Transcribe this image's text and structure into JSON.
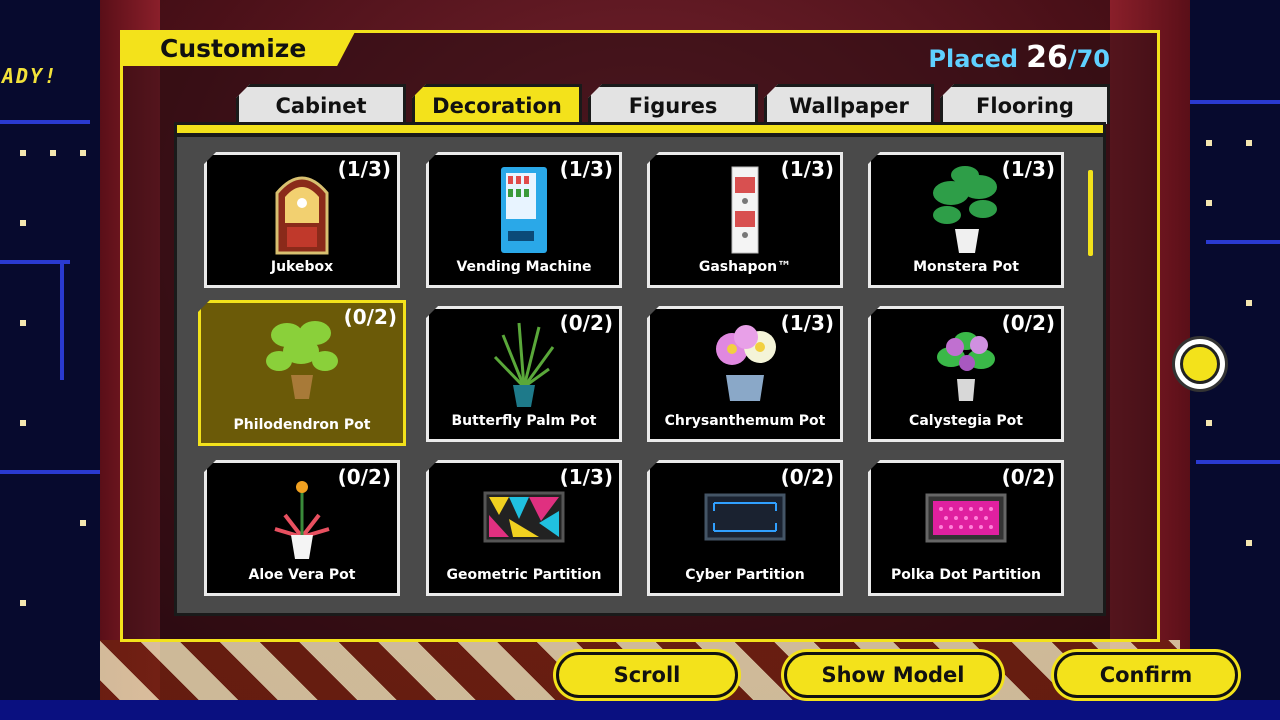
{
  "header": {
    "title": "Customize",
    "placed_label": "Placed",
    "placed_current": "26",
    "placed_total": "/70"
  },
  "background": {
    "ready_text": "ADY!"
  },
  "tabs": [
    {
      "label": "Cabinet",
      "active": false
    },
    {
      "label": "Decoration",
      "active": true
    },
    {
      "label": "Figures",
      "active": false
    },
    {
      "label": "Wallpaper",
      "active": false
    },
    {
      "label": "Flooring",
      "active": false
    }
  ],
  "items": [
    {
      "name": "Jukebox",
      "count": "(1/3)",
      "icon": "jukebox-icon"
    },
    {
      "name": "Vending Machine",
      "count": "(1/3)",
      "icon": "vending-machine-icon"
    },
    {
      "name": "Gashapon™",
      "count": "(1/3)",
      "icon": "gashapon-icon"
    },
    {
      "name": "Monstera Pot",
      "count": "(1/3)",
      "icon": "monstera-pot-icon"
    },
    {
      "name": "Philodendron Pot",
      "count": "(0/2)",
      "icon": "philodendron-pot-icon",
      "selected": true
    },
    {
      "name": "Butterfly Palm Pot",
      "count": "(0/2)",
      "icon": "butterfly-palm-pot-icon"
    },
    {
      "name": "Chrysanthemum Pot",
      "count": "(1/3)",
      "icon": "chrysanthemum-pot-icon"
    },
    {
      "name": "Calystegia Pot",
      "count": "(0/2)",
      "icon": "calystegia-pot-icon"
    },
    {
      "name": "Aloe Vera Pot",
      "count": "(0/2)",
      "icon": "aloe-vera-pot-icon"
    },
    {
      "name": "Geometric Partition",
      "count": "(1/3)",
      "icon": "geometric-partition-icon"
    },
    {
      "name": "Cyber Partition",
      "count": "(0/2)",
      "icon": "cyber-partition-icon"
    },
    {
      "name": "Polka Dot Partition",
      "count": "(0/2)",
      "icon": "polka-dot-partition-icon"
    }
  ],
  "buttons": {
    "scroll": "Scroll",
    "show_model": "Show Model",
    "confirm": "Confirm"
  },
  "colors": {
    "accent": "#f3e21b",
    "placed_blue": "#5fd0ff",
    "selected_bg": "#6b5a08"
  }
}
